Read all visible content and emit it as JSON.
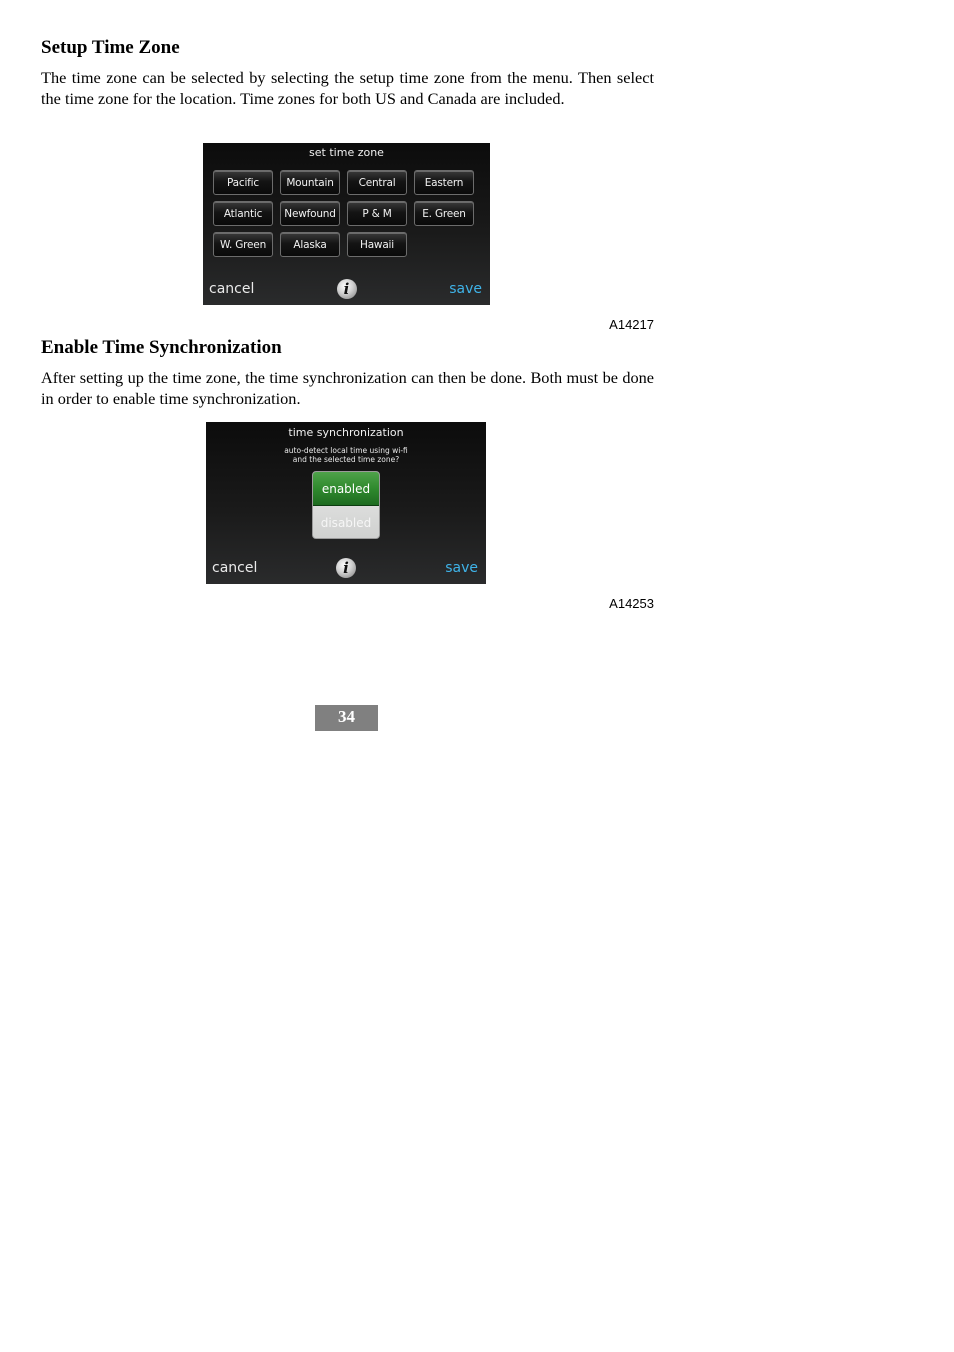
{
  "section1": {
    "heading": "Setup Time Zone",
    "paragraph": "The time zone can be selected by selecting the setup time zone from the menu. Then select the time zone for the location. Time zones for both US and Canada are included.",
    "figure_code": "A14217",
    "screen": {
      "title": "set time zone",
      "zones": [
        "Pacific",
        "Mountain",
        "Central",
        "Eastern",
        "Atlantic",
        "Newfound",
        "P & M",
        "E. Green",
        "W. Green",
        "Alaska",
        "Hawaii"
      ],
      "cancel_label": "cancel",
      "save_label": "save",
      "info_glyph": "i"
    }
  },
  "section2": {
    "heading": "Enable Time Synchronization",
    "paragraph": "After setting up the time zone, the time synchronization can then be done. Both must be done in order to enable time synchronization.",
    "figure_code": "A14253",
    "screen": {
      "title": "time synchronization",
      "subtitle_line1": "auto-detect local time using wi-fi",
      "subtitle_line2": "and the selected time zone?",
      "enabled_label": "enabled",
      "disabled_label": "disabled",
      "selected": "enabled",
      "cancel_label": "cancel",
      "save_label": "save",
      "info_glyph": "i"
    }
  },
  "page_number": "34",
  "colors": {
    "save_accent": "#3fb3e8",
    "enabled_green": "#2f8a2e",
    "page_number_bg": "#808080"
  }
}
